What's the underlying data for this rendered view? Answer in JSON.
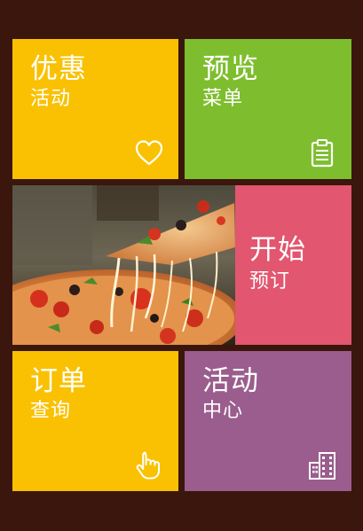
{
  "colors": {
    "background": "#3a160d",
    "promo_tile": "#f9c101",
    "menu_tile": "#7ebe2e",
    "booking_tile": "#e2566f",
    "order_tile": "#f9c101",
    "events_tile": "#9a5d8d"
  },
  "tiles": {
    "promo": {
      "title": "优惠",
      "subtitle": "活动",
      "icon": "heart-icon"
    },
    "menu": {
      "title": "预览",
      "subtitle": "菜单",
      "icon": "clipboard-icon"
    },
    "photo": {
      "image": "pizza-photo"
    },
    "booking": {
      "title": "开始",
      "subtitle": "预订"
    },
    "order": {
      "title": "订单",
      "subtitle": "查询",
      "icon": "hand-pointer-icon"
    },
    "events": {
      "title": "活动",
      "subtitle": "中心",
      "icon": "building-icon"
    }
  }
}
